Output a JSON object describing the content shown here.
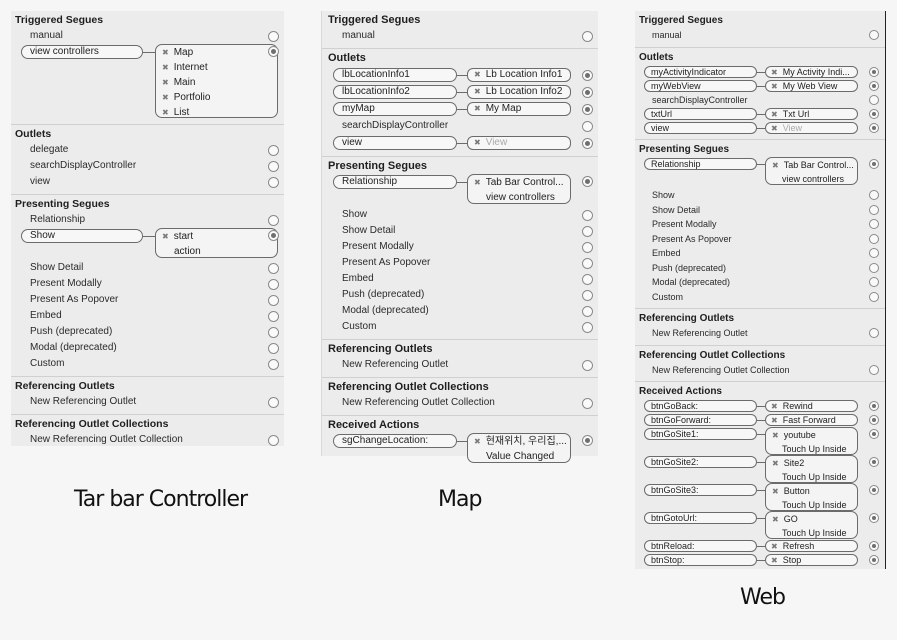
{
  "captions": {
    "tab_bar": "Tar bar Controller",
    "map": "Map",
    "web": "Web"
  },
  "tabbar": {
    "triggered_segues": {
      "title": "Triggered Segues",
      "manual": "manual",
      "view_controllers": "view controllers",
      "targets": [
        "Map",
        "Internet",
        "Main",
        "Portfolio",
        "List"
      ]
    },
    "outlets": {
      "title": "Outlets",
      "items": [
        "delegate",
        "searchDisplayController",
        "view"
      ]
    },
    "presenting_segues": {
      "title": "Presenting Segues",
      "relationship": "Relationship",
      "show": "Show",
      "show_targets": [
        "start",
        "action"
      ],
      "items": [
        "Show Detail",
        "Present Modally",
        "Present As Popover",
        "Embed",
        "Push (deprecated)",
        "Modal (deprecated)",
        "Custom"
      ]
    },
    "referencing_outlets": {
      "title": "Referencing Outlets",
      "item": "New Referencing Outlet"
    },
    "referencing_outlet_collections": {
      "title": "Referencing Outlet Collections",
      "item": "New Referencing Outlet Collection"
    }
  },
  "map": {
    "triggered_segues": {
      "title": "Triggered Segues",
      "manual": "manual"
    },
    "outlets": {
      "title": "Outlets",
      "connected": [
        {
          "source": "lbLocationInfo1",
          "target": "Lb Location Info1"
        },
        {
          "source": "lbLocationInfo2",
          "target": "Lb Location Info2"
        },
        {
          "source": "myMap",
          "target": "My Map"
        }
      ],
      "plain": "searchDisplayController",
      "view": {
        "source": "view",
        "target": "View"
      }
    },
    "presenting_segues": {
      "title": "Presenting Segues",
      "relationship": "Relationship",
      "targets": [
        "Tab Bar Control...",
        "view controllers"
      ],
      "items": [
        "Show",
        "Show Detail",
        "Present Modally",
        "Present As Popover",
        "Embed",
        "Push (deprecated)",
        "Modal (deprecated)",
        "Custom"
      ]
    },
    "referencing_outlets": {
      "title": "Referencing Outlets",
      "item": "New Referencing Outlet"
    },
    "referencing_outlet_collections": {
      "title": "Referencing Outlet Collections",
      "item": "New Referencing Outlet Collection"
    },
    "received_actions": {
      "title": "Received Actions",
      "source": "sgChangeLocation:",
      "targets": [
        "현재위치, 우리집,...",
        "Value Changed"
      ]
    }
  },
  "web": {
    "triggered_segues": {
      "title": "Triggered Segues",
      "manual": "manual"
    },
    "outlets": {
      "title": "Outlets",
      "connected1": [
        {
          "source": "myActivityIndicator",
          "target": "My Activity Indi..."
        },
        {
          "source": "myWebView",
          "target": "My Web View"
        }
      ],
      "plain": "searchDisplayController",
      "connected2": [
        {
          "source": "txtUrl",
          "target": "Txt Url"
        },
        {
          "source": "view",
          "target": "View"
        }
      ]
    },
    "presenting_segues": {
      "title": "Presenting Segues",
      "relationship": "Relationship",
      "targets": [
        "Tab Bar Control...",
        "view controllers"
      ],
      "items": [
        "Show",
        "Show Detail",
        "Present Modally",
        "Present As Popover",
        "Embed",
        "Push (deprecated)",
        "Modal (deprecated)",
        "Custom"
      ]
    },
    "referencing_outlets": {
      "title": "Referencing Outlets",
      "item": "New Referencing Outlet"
    },
    "referencing_outlet_collections": {
      "title": "Referencing Outlet Collections",
      "item": "New Referencing Outlet Collection"
    },
    "received_actions": {
      "title": "Received Actions",
      "btn_go_back": {
        "source": "btnGoBack:",
        "target": "Rewind"
      },
      "btn_go_forward": {
        "source": "btnGoForward:",
        "target": "Fast Forward"
      },
      "btn_go_site1": {
        "source": "btnGoSite1:",
        "target": "youtube",
        "event": "Touch Up Inside"
      },
      "btn_go_site2": {
        "source": "btnGoSite2:",
        "target": "Site2",
        "event": "Touch Up Inside"
      },
      "btn_go_site3": {
        "source": "btnGoSite3:",
        "target": "Button",
        "event": "Touch Up Inside"
      },
      "btn_goto_url": {
        "source": "btnGotoUrl:",
        "target": "GO",
        "event": "Touch Up Inside"
      },
      "btn_reload": {
        "source": "btnReload:",
        "target": "Refresh"
      },
      "btn_stop": {
        "source": "btnStop:",
        "target": "Stop"
      }
    }
  }
}
